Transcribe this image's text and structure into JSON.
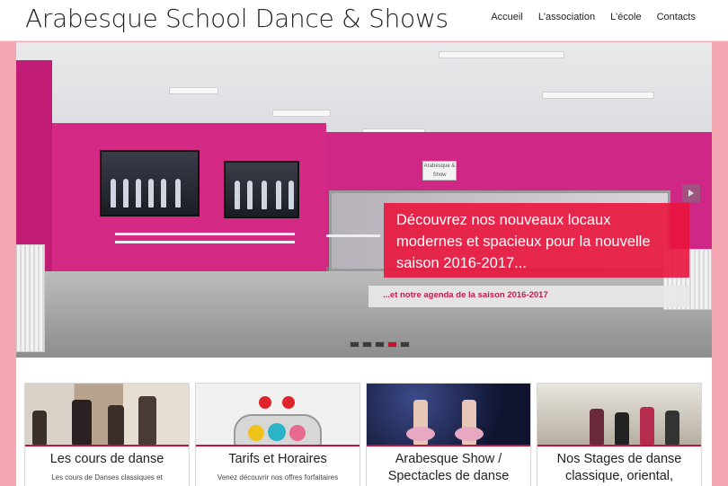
{
  "header": {
    "site_title": "Arabesque School Dance & Shows",
    "nav": [
      "Accueil",
      "L'association",
      "L'école",
      "Contacts"
    ]
  },
  "slider": {
    "caption": "Découvrez nos nouveaux locaux modernes et spacieux pour la nouvelle saison 2016-2017...",
    "link_text": "...et notre agenda de la saison 2016-2017",
    "sign_text": "Arabesque & Show",
    "slide_count": 5,
    "active_slide": 4,
    "colors": {
      "caption_bg": "#e9143c",
      "link_text": "#c31d4a",
      "active_dot": "#c4122f",
      "page_bg": "#f4a7b2"
    }
  },
  "cards": [
    {
      "title": "Les cours de danse",
      "text": "Les cours de Danses classiques et"
    },
    {
      "title": "Tarifs et Horaires",
      "text": "Venez découvrir nos offres forfaitaires"
    },
    {
      "title": "Arabesque Show / Spectacles de danse",
      "text": ""
    },
    {
      "title": "Nos Stages de danse classique, oriental,",
      "text": ""
    }
  ]
}
